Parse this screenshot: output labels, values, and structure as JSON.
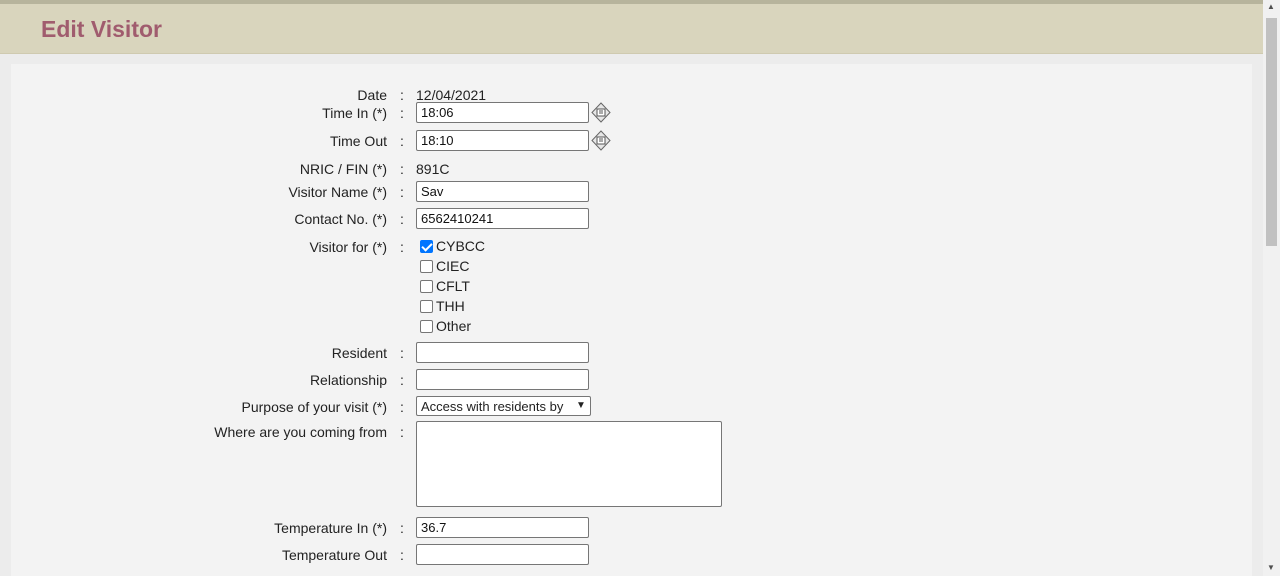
{
  "page": {
    "title": "Edit Visitor"
  },
  "form": {
    "date": {
      "label": "Date",
      "value": "12/04/2021"
    },
    "time_in": {
      "label": "Time In (*)",
      "value": "18:06"
    },
    "time_out": {
      "label": "Time Out",
      "value": "18:10"
    },
    "nric": {
      "label": "NRIC / FIN (*)",
      "value": "891C"
    },
    "visitor_name": {
      "label": "Visitor Name (*)",
      "value": "Sav"
    },
    "contact_no": {
      "label": "Contact No. (*)",
      "value": "6562410241"
    },
    "visitor_for": {
      "label": "Visitor for (*)",
      "options": [
        {
          "label": "CYBCC",
          "checked": true
        },
        {
          "label": "CIEC",
          "checked": false
        },
        {
          "label": "CFLT",
          "checked": false
        },
        {
          "label": "THH",
          "checked": false
        },
        {
          "label": "Other",
          "checked": false
        }
      ]
    },
    "resident": {
      "label": "Resident",
      "value": ""
    },
    "relationship": {
      "label": "Relationship",
      "value": ""
    },
    "purpose": {
      "label": "Purpose of your visit (*)",
      "selected": "Access with residents by"
    },
    "coming_from": {
      "label": "Where are you coming from",
      "value": ""
    },
    "temp_in": {
      "label": "Temperature In (*)",
      "value": "36.7"
    },
    "temp_out": {
      "label": "Temperature Out",
      "value": ""
    }
  },
  "colon": ":",
  "colors": {
    "header_bg": "#d9d5bd",
    "title": "#a05c6e",
    "checkbox": "#0075ff"
  }
}
